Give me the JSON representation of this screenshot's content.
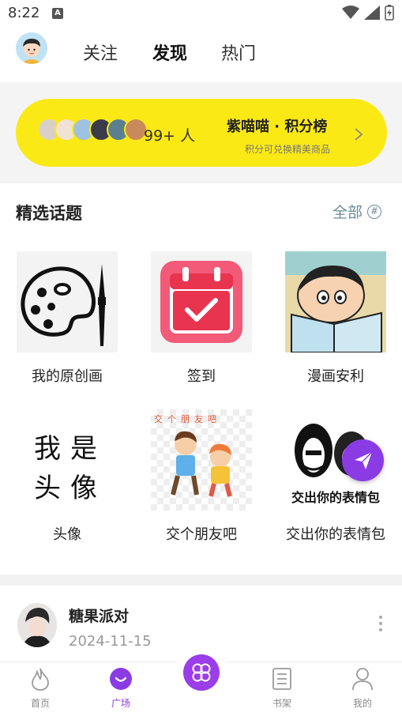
{
  "status": {
    "time": "8:22",
    "a_badge": "A"
  },
  "header": {
    "tabs": [
      {
        "label": "关注",
        "active": false
      },
      {
        "label": "发现",
        "active": true
      },
      {
        "label": "热门",
        "active": false
      }
    ]
  },
  "ranking": {
    "count": "99+ 人",
    "title": "紫喵喵 · 积分榜",
    "subtitle": "积分可兑换精美商品"
  },
  "topics": {
    "title": "精选话题",
    "all_label": "全部",
    "hash": "#",
    "items": [
      {
        "label": "我的原创画",
        "icon": "paint-palette"
      },
      {
        "label": "签到",
        "icon": "calendar-check"
      },
      {
        "label": "漫画安利",
        "icon": "comic-reading"
      },
      {
        "label": "头像",
        "icon": "text-avatar",
        "art_text": [
          "我",
          "是",
          "头",
          "像"
        ]
      },
      {
        "label": "交个朋友吧",
        "icon": "kids-friends",
        "art_text": "交个朋友吧"
      },
      {
        "label": "交出你的表情包",
        "icon": "meme-stickers",
        "art_text": "交出你的表情包"
      }
    ]
  },
  "post": {
    "name": "糖果派对",
    "date": "2024-11-15"
  },
  "bottom_nav": [
    {
      "label": "首页",
      "icon": "flame-icon"
    },
    {
      "label": "广场",
      "icon": "smile-icon",
      "active": true
    },
    {
      "label": "书架",
      "icon": "book-icon"
    },
    {
      "label": "我的",
      "icon": "user-icon"
    }
  ],
  "colors": {
    "accent": "#8b3be4",
    "banner": "#fbe916"
  }
}
